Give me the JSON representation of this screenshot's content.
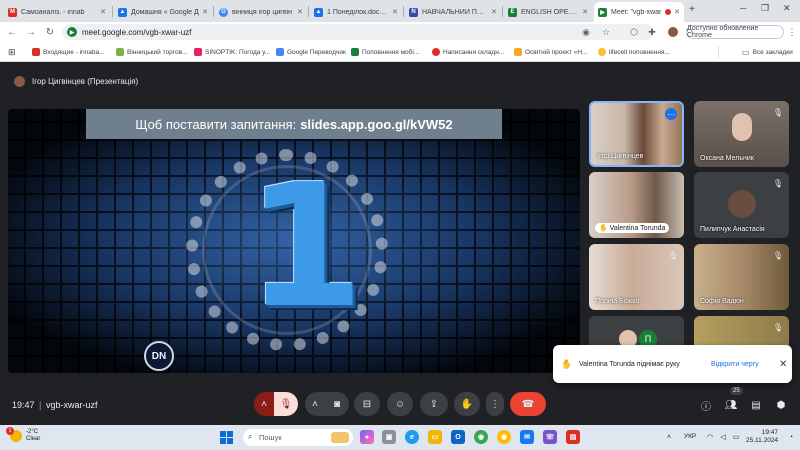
{
  "browser": {
    "tabs": [
      {
        "title": "Самоаналіз. - innab",
        "color": "#d93025"
      },
      {
        "title": "Домашня « Google Д",
        "color": "#1a73e8"
      },
      {
        "title": "вінниця ігор цигвін",
        "color": "#4285f4"
      },
      {
        "title": "1 Понеділок.docx - G",
        "color": "#1a73e8"
      },
      {
        "title": "НАВЧАЛЬНИЙ ПОРТ",
        "color": "#3949ab"
      },
      {
        "title": "ENGLISH OPENS THE",
        "color": "#188038"
      },
      {
        "title": "Meet: \"vgb-xwar",
        "color": "#188038"
      }
    ],
    "new_tab": "+",
    "url": "meet.google.com/vgb-xwar-uzf",
    "update_label": "Доступно обновление Chrome",
    "bookmarks": [
      {
        "label": "Входящие - innaba...",
        "color": "#d93025"
      },
      {
        "label": "Вінницький торгов...",
        "color": "#7cb342"
      },
      {
        "label": "SINOPTIK: Погода у...",
        "color": "#e91e63"
      },
      {
        "label": "Google Переводчик",
        "color": "#4285f4"
      },
      {
        "label": "Поповнення мобі...",
        "color": "#188038"
      },
      {
        "label": "Написання складн...",
        "color": "#d93025"
      },
      {
        "label": "Освітній проект «Н...",
        "color": "#f9a825"
      },
      {
        "label": "lifecell поповнення...",
        "color": "#fbc02d"
      }
    ],
    "all_bookmarks": "Все закладки"
  },
  "meet": {
    "presenter_label": "Ігор Цигвінцев (Презентація)",
    "slide": {
      "question_prefix": "Щоб поставити запитання:",
      "question_link": "slides.app.goo.gl/kVW52",
      "countdown": "1",
      "logo": "DN"
    },
    "participants": [
      {
        "name": "Ігор Цигвінцев",
        "bg": "#b89a86",
        "active": true,
        "muted": false
      },
      {
        "name": "Оксана Мельник",
        "bg": "#6d6259",
        "active": false,
        "muted": true
      },
      {
        "name": "Valentina Torunda",
        "bg": "#8c7a6a",
        "active": false,
        "muted": false,
        "hand": true
      },
      {
        "name": "Пилипчук Анастасія",
        "bg": "#3c4043",
        "active": false,
        "muted": true,
        "avatar": true
      },
      {
        "name": "Поліна Божко",
        "bg": "#a48d80",
        "active": false,
        "muted": true
      },
      {
        "name": "Софія Вадюн",
        "bg": "#8f7a5a",
        "active": false,
        "muted": true
      },
      {
        "name": "",
        "bg": "#3c4043",
        "active": false,
        "muted": false,
        "initial": "П"
      },
      {
        "name": "",
        "bg": "#9a8650",
        "active": false,
        "muted": true
      }
    ],
    "toast": {
      "message": "Valentina Torunda піднімає руку",
      "action": "Відкрити чергу"
    },
    "controls": {
      "time": "19:47",
      "meeting_code": "vgb-xwar-uzf",
      "people_count": "25"
    }
  },
  "taskbar": {
    "weather_temp": "-2°C",
    "weather_desc": "Clear",
    "notification_count": "1",
    "search_placeholder": "Пошук",
    "language": "УКР",
    "time": "19:47",
    "date": "25.11.2024"
  }
}
